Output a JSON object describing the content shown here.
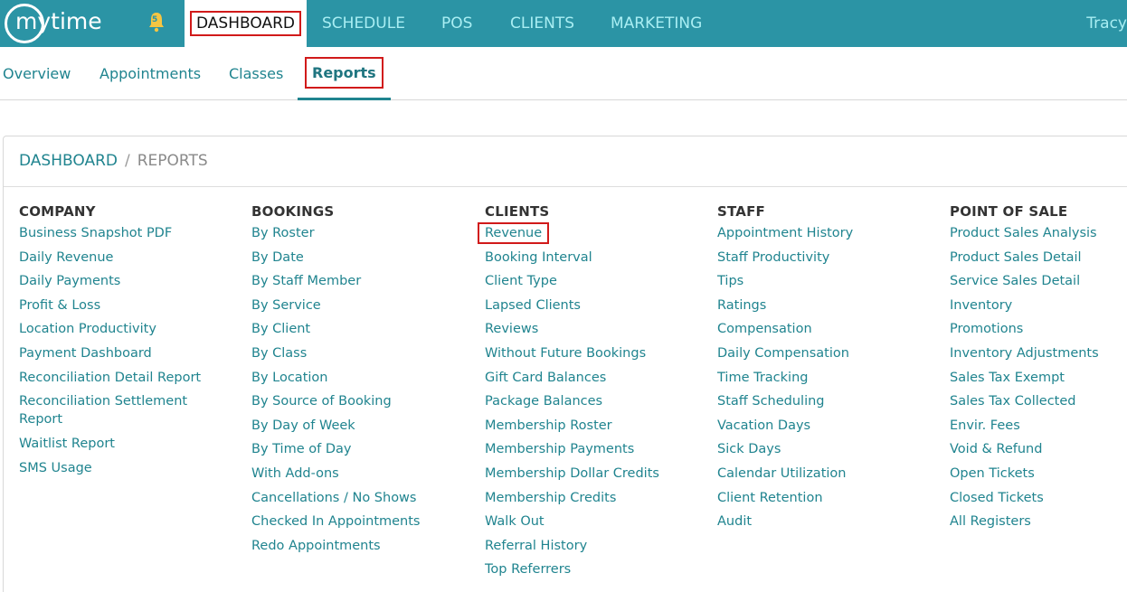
{
  "topnav": {
    "logo": "mytime",
    "bell_count": "5",
    "items": [
      {
        "label": "DASHBOARD",
        "active": true
      },
      {
        "label": "SCHEDULE"
      },
      {
        "label": "POS"
      },
      {
        "label": "CLIENTS"
      },
      {
        "label": "MARKETING"
      }
    ],
    "user": "Tracy"
  },
  "subnav": {
    "items": [
      {
        "label": "Overview"
      },
      {
        "label": "Appointments"
      },
      {
        "label": "Classes"
      },
      {
        "label": "Reports",
        "active": true
      }
    ]
  },
  "breadcrumb": {
    "root": "DASHBOARD",
    "separator": "/",
    "current": "REPORTS"
  },
  "columns": [
    {
      "title": "COMPANY",
      "items": [
        "Business Snapshot PDF",
        "Daily Revenue",
        "Daily Payments",
        "Profit & Loss",
        "Location Productivity",
        "Payment Dashboard",
        "Reconciliation Detail Report",
        "Reconciliation Settlement Report",
        "Waitlist Report",
        "SMS Usage"
      ]
    },
    {
      "title": "BOOKINGS",
      "items": [
        "By Roster",
        "By Date",
        "By Staff Member",
        "By Service",
        "By Client",
        "By Class",
        "By Location",
        "By Source of Booking",
        "By Day of Week",
        "By Time of Day",
        "With Add-ons",
        "Cancellations / No Shows",
        "Checked In Appointments",
        "Redo Appointments"
      ]
    },
    {
      "title": "CLIENTS",
      "items": [
        "Revenue",
        "Booking Interval",
        "Client Type",
        "Lapsed Clients",
        "Reviews",
        "Without Future Bookings",
        "Gift Card Balances",
        "Package Balances",
        "Membership Roster",
        "Membership Payments",
        "Membership Dollar Credits",
        "Membership Credits",
        "Walk Out",
        "Referral History",
        "Top Referrers"
      ]
    },
    {
      "title": "STAFF",
      "items": [
        "Appointment History",
        "Staff Productivity",
        "Tips",
        "Ratings",
        "Compensation",
        "Daily Compensation",
        "Time Tracking",
        "Staff Scheduling",
        "Vacation Days",
        "Sick Days",
        "Calendar Utilization",
        "Client Retention",
        "Audit"
      ]
    },
    {
      "title": "POINT OF SALE",
      "items": [
        "Product Sales Analysis",
        "Product Sales Detail",
        "Service Sales Detail",
        "Inventory",
        "Promotions",
        "Inventory Adjustments",
        "Sales Tax Exempt",
        "Sales Tax Collected",
        "Envir. Fees",
        "Void & Refund",
        "Open Tickets",
        "Closed Tickets",
        "All Registers"
      ]
    }
  ],
  "colors": {
    "brand": "#2b94a5",
    "link": "#20848f",
    "highlight": "#d11a1a"
  }
}
